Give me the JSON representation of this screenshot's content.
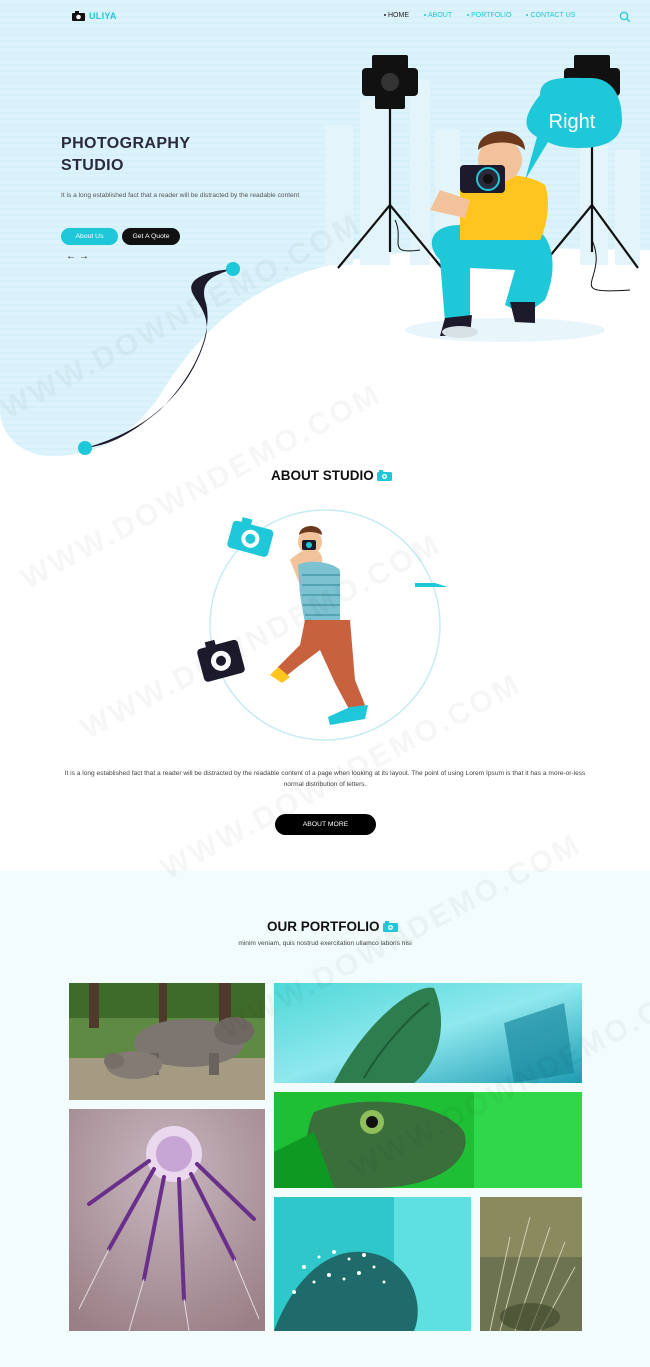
{
  "brand": {
    "name": "ULIYA",
    "logo_icon": "camera-icon"
  },
  "nav": {
    "items": [
      {
        "label": "HOME",
        "active": true
      },
      {
        "label": "ABOUT",
        "active": false
      },
      {
        "label": "PORTFOLIO",
        "active": false
      },
      {
        "label": "CONTACT US",
        "active": false
      }
    ],
    "search_icon": "search-icon"
  },
  "hero": {
    "title_line1": "PHOTOGRAPHY",
    "title_line2": "STUDIO",
    "description": "It is a long established fact that a reader will be distracted by the readable content",
    "btn_about": "About Us",
    "btn_quote": "Get A Quote",
    "arrow_prev": "←",
    "arrow_next": "→",
    "speech_bubble": "Right"
  },
  "about": {
    "title": "ABOUT STUDIO",
    "description": "It is a long established fact that a reader will be distracted by the readable content of a page when looking at its layout. The point of using Lorem Ipsum is that it has a more-or-less normal distribution of letters.",
    "button": "ABOUT MORE"
  },
  "portfolio": {
    "title": "OUR PORTFOLIO",
    "subtitle": "minim veniam, quis nostrud exercitation ullamco laboris nisi",
    "photos": [
      "rhinos",
      "butterfly-wing",
      "butterfly-eye",
      "purple-dandelion",
      "dew-dandelion",
      "seed-closeup"
    ]
  },
  "watermark": "WWW.DOWNDEMO.COM",
  "colors": {
    "accent": "#1ec8d8",
    "dark": "#111111",
    "hero_bg": "#dff4fb"
  }
}
